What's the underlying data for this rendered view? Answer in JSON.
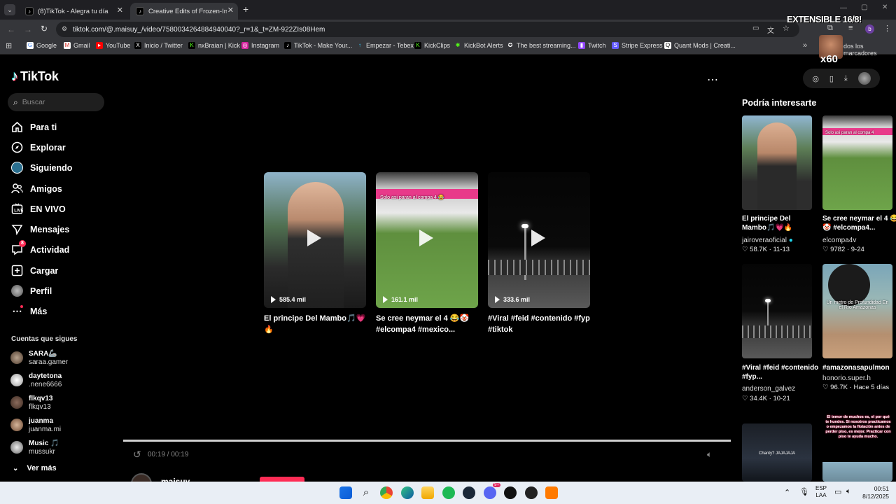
{
  "browser": {
    "tabs": [
      {
        "title": "(8)TikTok - Alegra tu día",
        "active": false
      },
      {
        "title": "Creative Edits of Frozen-Inspire",
        "active": true
      }
    ],
    "new_tab": "+",
    "url": "tiktok.com/@.maisuy_/video/7580034264884940040?_r=1&_t=ZM-922ZIs08Hem",
    "bookmarks": [
      "Google",
      "Gmail",
      "YouTube",
      "Inicio / Twitter",
      "nxBraian | Kick",
      "Instagram",
      "TikTok - Make Your...",
      "Empezar - Tebex",
      "KickClips",
      "KickBot Alerts",
      "The best streaming...",
      "Twitch",
      "Stripe Express",
      "Quant Mods | Creati..."
    ],
    "bookmarks_more": "dos los marcadores",
    "overlay_title": "EXTENSIBLE 16/8!",
    "overlay_multiplier": "x60"
  },
  "sidebar": {
    "logo": "TikTok",
    "search_placeholder": "Buscar",
    "items": [
      {
        "label": "Para ti",
        "icon": "home-icon"
      },
      {
        "label": "Explorar",
        "icon": "compass-icon"
      },
      {
        "label": "Siguiendo",
        "icon": "following-icon"
      },
      {
        "label": "Amigos",
        "icon": "friends-icon"
      },
      {
        "label": "EN VIVO",
        "icon": "live-icon"
      },
      {
        "label": "Mensajes",
        "icon": "messages-icon"
      },
      {
        "label": "Actividad",
        "icon": "activity-icon"
      },
      {
        "label": "Cargar",
        "icon": "upload-icon"
      },
      {
        "label": "Perfil",
        "icon": "profile-icon"
      },
      {
        "label": "Más",
        "icon": "more-icon"
      }
    ],
    "activity_badge": "8",
    "following_title": "Cuentas que sigues",
    "accounts": [
      {
        "name": "SARA🦾",
        "user": "saraa.gamer"
      },
      {
        "name": "daytetona",
        "user": ".nene6666"
      },
      {
        "name": "flkqv13",
        "user": "flkqv13"
      },
      {
        "name": "juanma",
        "user": "juanma.mi"
      },
      {
        "name": "Music 🎵",
        "user": "mussukr"
      }
    ],
    "see_more": "Ver más"
  },
  "main": {
    "cards": [
      {
        "views": "585.4 mil",
        "caption": "El principe Del Mambo🎵💗🔥",
        "overlay": ""
      },
      {
        "views": "161.1 mil",
        "caption": "Se cree neymar el 4 😂🤡 #elcompa4 #mexico...",
        "overlay": "Solo asi paran al compa 4 😂"
      },
      {
        "views": "333.6 mil",
        "caption": "#Viral #feid #contenido #fyp #tiktok",
        "overlay": ""
      }
    ],
    "time": "00:19 / 00:19",
    "progress": 1.0,
    "author": "maisuy"
  },
  "right": {
    "title": "Podría interesarte",
    "items": [
      {
        "title": "El principe Del Mambo🎵💗🔥",
        "user": "jairoveraoficial",
        "verified": true,
        "likes": "58.7K",
        "date": "11-13"
      },
      {
        "title": "Se cree neymar el 4 😂🤡 #elcompa4...",
        "user": "elcompa4v",
        "verified": false,
        "likes": "9782",
        "date": "9-24"
      },
      {
        "title": "#Viral #feid #contenido #fyp...",
        "user": "anderson_galvez",
        "verified": false,
        "likes": "34.4K",
        "date": "10-21"
      },
      {
        "title": "#amazonasapulmon",
        "user": "honorio.super.h",
        "verified": false,
        "likes": "96.7K",
        "date": "Hace 5 días"
      }
    ],
    "thumb2_overlay": "Solo asi paran al compa 4",
    "thumb4_overlay": "Un metro de Profundidad En el Río Amazonas",
    "thumb5_overlay": "Chanty? JAJAJAJA",
    "thumb6_overlay": "El temor de muchos es, el por qué te hundes. Si nosotros practicamos o empezamos la flotación antes de perder piso, es mejor. Practicar con piso te ayuda mucho."
  },
  "taskbar": {
    "lang": "ESP",
    "lang2": "LAA",
    "time": "00:51",
    "date": "8/12/2025",
    "badge": "9+"
  },
  "colors": {
    "accent": "#fe2c55",
    "bg": "#000000",
    "chrome": "#35363a"
  }
}
